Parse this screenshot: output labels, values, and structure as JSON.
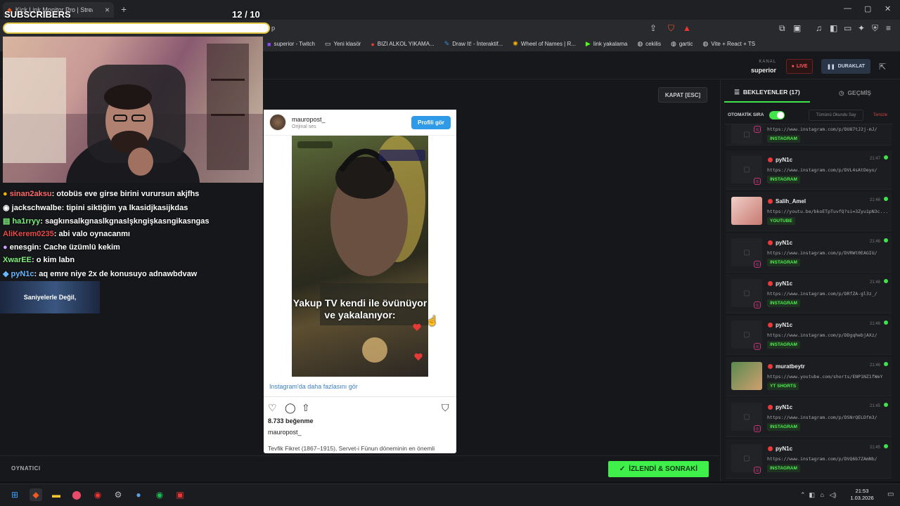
{
  "browser": {
    "tab_title": "Kick Link Monitor Pro | Stream...",
    "url_tail": "p",
    "bookmarks": [
      {
        "label": "superior - Twitch",
        "icon": "twitch-icon"
      },
      {
        "label": "Yeni klasör",
        "icon": "folder-icon"
      },
      {
        "label": "BIZI ALKOL YIKAMA...",
        "icon": "youtube-icon"
      },
      {
        "label": "Draw It! - İnteraktif...",
        "icon": "pen-icon"
      },
      {
        "label": "Wheel of Names | R...",
        "icon": "wheel-icon"
      },
      {
        "label": "link yakalama",
        "icon": "kick-icon"
      },
      {
        "label": "cekilis",
        "icon": "globe-icon"
      },
      {
        "label": "gartic",
        "icon": "globe-icon"
      },
      {
        "label": "Vite + React + TS",
        "icon": "vite-icon"
      }
    ]
  },
  "overlay": {
    "subs_label": "SUBSCRIBERS",
    "subs_count": "12  / 10"
  },
  "chat": [
    {
      "user": "sinan2aksu",
      "text": " otobüs eve girse birini vurursun akjfhs",
      "color": "#ff6a6a"
    },
    {
      "user": "jackschwalbe",
      "text": " tipini siktiğim ya lkasidjkasijkdas",
      "color": "#ffffff"
    },
    {
      "user": "ha1rryy",
      "text": " sagkınsalkgnaslkgnaslşkngişkasngikasngas",
      "color": "#7ff07f"
    },
    {
      "user": "AliKerem0235",
      "text": " abi valo oynacanmı",
      "color": "#e84b4b"
    },
    {
      "user": "enesgin",
      "text": " Cache üzümlü kekim",
      "color": "#ffffff"
    },
    {
      "user": "XwarEE",
      "text": " o kim labn",
      "color": "#7ff07f"
    },
    {
      "user": "pyN1c",
      "text": " aq emre niye 2x de konusuyo adnawbdvaw",
      "color": "#6ab7ff"
    }
  ],
  "banner_text": "Saniyelerle Değil,",
  "header": {
    "channel_label": "KANAL",
    "channel_name": "superior",
    "live_label": "LIVE",
    "pause_label": "DURAKLAT",
    "close_label": "KAPAT [ESC]"
  },
  "instagram": {
    "username": "mauropost_",
    "audio": "Orijinal ses",
    "profile_btn": "Profili gör",
    "caption": "Yakup TV kendi ile övünüyor ve yakalanıyor:",
    "more_link": "Instagram'da daha fazlasını gör",
    "likes": "8.733 beğenme",
    "desc": "Tevfik Fikret (1867–1915), Servet-i Fünun döneminin en önemli"
  },
  "footer": {
    "player_label": "OYNATICI",
    "next_label": "İZLENDİ & SONRAKİ"
  },
  "sidebar": {
    "tab_queue": "BEKLEYENLER (17)",
    "tab_history": "GEÇMİŞ",
    "autoqueue_label": "OTOMATİK SIRA",
    "autoqueue_on": true,
    "mark_all_label": "Tümünü Okundu Say",
    "clear_label": "Temizle",
    "items": [
      {
        "name": "",
        "time": "",
        "url": "https://www.instagram.com/p/DU87tJ2j-mJ/",
        "tag": "INSTAGRAM"
      },
      {
        "name": "pyN1c",
        "time": "21:47",
        "url": "https://www.instagram.com/p/DVL4sAtDeyo/",
        "tag": "INSTAGRAM"
      },
      {
        "name": "Salih_Amel",
        "time": "21:46",
        "url": "https://youtu.be/bkoETpTuvfQ?si=3Zyu1pN3c...",
        "tag": "YOUTUBE"
      },
      {
        "name": "pyN1c",
        "time": "21:46",
        "url": "https://www.instagram.com/p/DVRWt0EAGIU/",
        "tag": "INSTAGRAM"
      },
      {
        "name": "pyN1c",
        "time": "21:46",
        "url": "https://www.instagram.com/p/DRfZA-gl3z_/",
        "tag": "INSTAGRAM"
      },
      {
        "name": "pyN1c",
        "time": "21:46",
        "url": "https://www.instagram.com/p/DDgqhebjAXz/",
        "tag": "INSTAGRAM"
      },
      {
        "name": "muratbeytr",
        "time": "21:46",
        "url": "https://www.youtube.com/shorts/ENP1NZ1fWeY",
        "tag": "YT SHORTS"
      },
      {
        "name": "pyN1c",
        "time": "21:45",
        "url": "https://www.instagram.com/p/DSNrQELDfm3/",
        "tag": "INSTAGRAM"
      },
      {
        "name": "pyN1c",
        "time": "21:45",
        "url": "https://www.instagram.com/p/DVQ6b7ZAmNb/",
        "tag": "INSTAGRAM"
      }
    ]
  },
  "taskbar": {
    "time": "21:53",
    "date": "1.03.2026"
  },
  "colors": {
    "accent_green": "#3fe44a",
    "live_red": "#ff5b5b",
    "instagram_blue": "#2f9ae8"
  }
}
